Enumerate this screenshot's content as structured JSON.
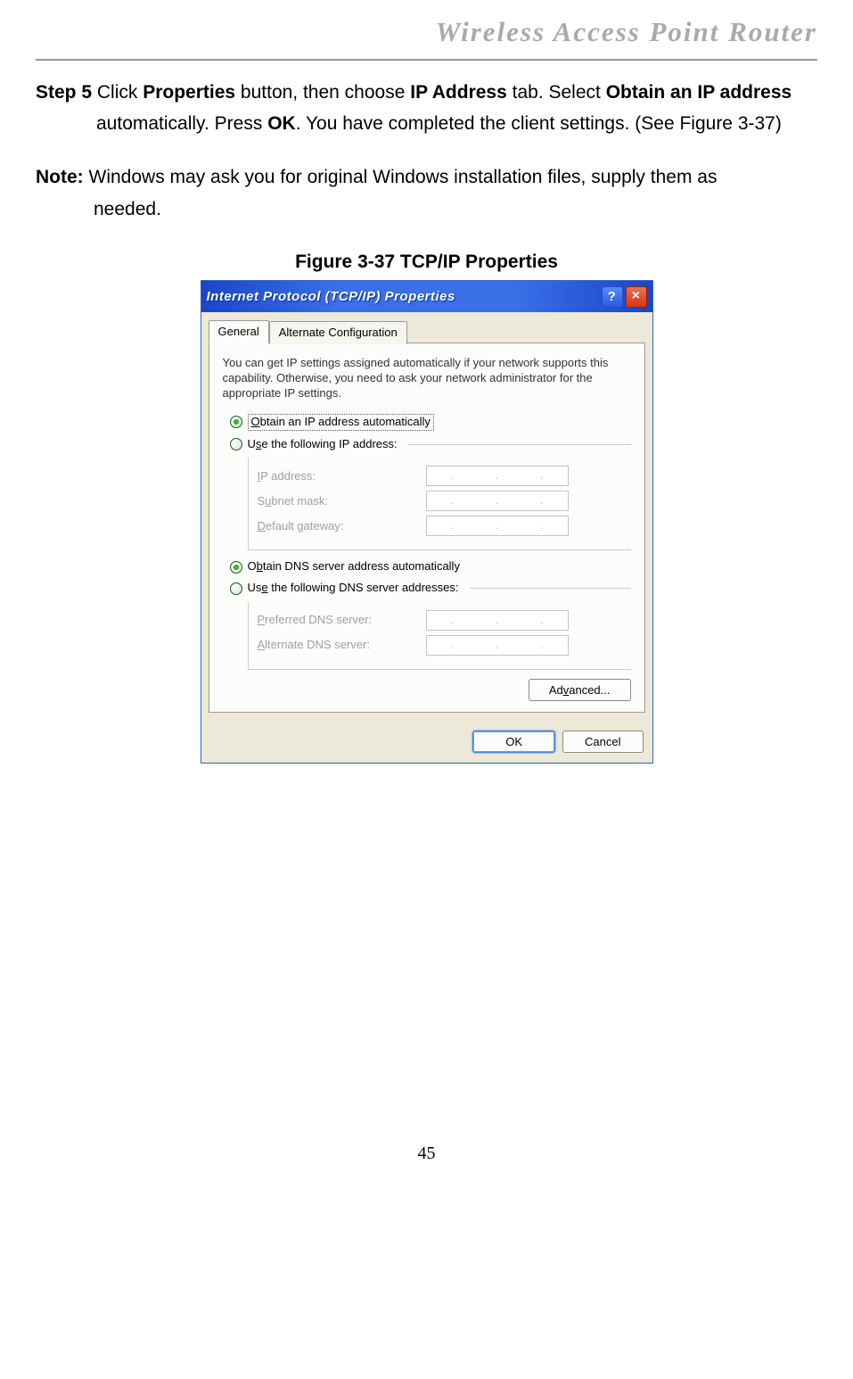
{
  "header": {
    "title": "Wireless Access Point Router"
  },
  "step": {
    "label": "Step 5",
    "text_parts": {
      "part1": " Click ",
      "bold1": "Properties",
      "part2": " button, then choose ",
      "bold2": "IP Address",
      "part3": " tab. Select ",
      "bold3": "Obtain an IP address",
      "part4": " automatically. Press ",
      "bold4": "OK",
      "part5": ". You have completed the client settings. (See Figure 3-37)"
    }
  },
  "note": {
    "label": "Note:",
    "text": " Windows may ask you for original Windows installation files, supply them as needed."
  },
  "figure": {
    "caption": "Figure 3-37 TCP/IP Properties"
  },
  "dialog": {
    "title": "Internet Protocol (TCP/IP) Properties",
    "tabs": {
      "general": "General",
      "alt": "Alternate Configuration"
    },
    "explain": "You can get IP settings assigned automatically if your network supports this capability. Otherwise, you need to ask your network administrator for the appropriate IP settings.",
    "ip": {
      "auto": "Obtain an IP address automatically",
      "manual_pre": "U",
      "manual": "se the following IP address:",
      "fields": {
        "ip_pre": "I",
        "ip": "P address:",
        "subnet_pre": "S",
        "subnet": "ubnet mask:",
        "gw_pre": "D",
        "gw": "efault gateway:"
      }
    },
    "dns": {
      "auto_pre": "O",
      "auto_mid": "b",
      "auto_post": "tain DNS server address automatically",
      "manual_pre": "Us",
      "manual_mid": "e",
      "manual_post": " the following DNS server addresses:",
      "fields": {
        "pref_pre": "P",
        "pref": "referred DNS server:",
        "alt_pre": "A",
        "alt": "lternate DNS server:"
      }
    },
    "buttons": {
      "advanced_pre": "Ad",
      "advanced_mid": "v",
      "advanced_post": "anced...",
      "ok": "OK",
      "cancel": "Cancel"
    }
  },
  "page_number": "45"
}
